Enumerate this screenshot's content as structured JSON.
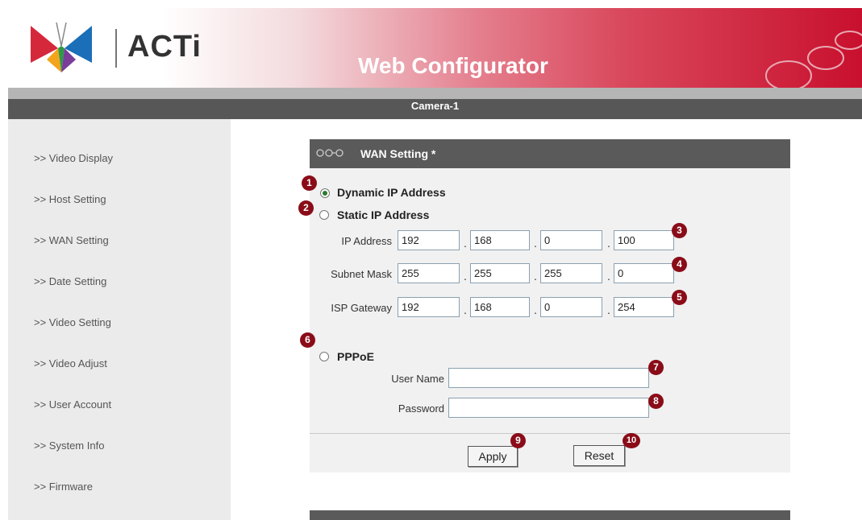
{
  "header": {
    "brand": "ACTi",
    "title": "Web Configurator"
  },
  "camera_bar": {
    "name": "Camera-1"
  },
  "sidebar": {
    "items": [
      {
        "label": ">> Video Display"
      },
      {
        "label": ">> Host Setting"
      },
      {
        "label": ">> WAN Setting"
      },
      {
        "label": ">> Date Setting"
      },
      {
        "label": ">> Video Setting"
      },
      {
        "label": ">> Video Adjust"
      },
      {
        "label": ">> User Account"
      },
      {
        "label": ">> System Info"
      },
      {
        "label": ">> Firmware"
      }
    ]
  },
  "panel": {
    "title": "WAN Setting *",
    "dynamic_label": "Dynamic IP Address",
    "static_label": "Static IP Address",
    "pppoe_label": "PPPoE",
    "selected": "Dynamic IP Address",
    "ip_address": {
      "label": "IP Address",
      "octets": [
        "192",
        "168",
        "0",
        "100"
      ]
    },
    "subnet_mask": {
      "label": "Subnet Mask",
      "octets": [
        "255",
        "255",
        "255",
        "0"
      ]
    },
    "isp_gateway": {
      "label": "ISP Gateway",
      "octets": [
        "192",
        "168",
        "0",
        "254"
      ]
    },
    "separator": ".",
    "user_name": {
      "label": "User Name",
      "value": ""
    },
    "password": {
      "label": "Password",
      "value": ""
    },
    "apply_label": "Apply",
    "reset_label": "Reset"
  },
  "badges": [
    "1",
    "2",
    "3",
    "4",
    "5",
    "6",
    "7",
    "8",
    "9",
    "10"
  ],
  "colors": {
    "brand_red": "#c8102e",
    "bar_gray": "#575757",
    "badge": "#8a0c18",
    "radio_selected": "#2a7a2a"
  }
}
